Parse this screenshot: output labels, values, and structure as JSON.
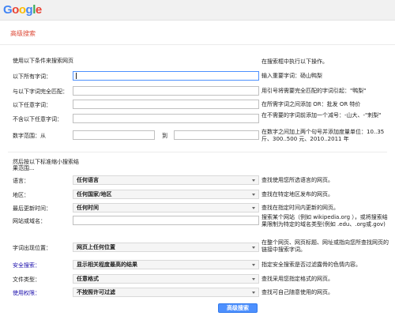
{
  "logo": {
    "letters": [
      {
        "char": "G",
        "color": "#4285f4"
      },
      {
        "char": "o",
        "color": "#ea4335"
      },
      {
        "char": "o",
        "color": "#fbbc05"
      },
      {
        "char": "g",
        "color": "#4285f4"
      },
      {
        "char": "l",
        "color": "#34a853"
      },
      {
        "char": "e",
        "color": "#ea4335"
      }
    ]
  },
  "page": {
    "title": "高级搜索"
  },
  "find": {
    "heading": "使用以下条件来搜索网页",
    "right_heading": "在搜索框中执行以下操作。",
    "rows": [
      {
        "label": "以下所有字词：",
        "value": "",
        "hint": "输入重要字词：砀山鸭梨"
      },
      {
        "label": "与以下字词完全匹配：",
        "value": "",
        "hint": "用引号将需要完全匹配的字词引起：\"鸭梨\""
      },
      {
        "label": "以下任意字词：",
        "value": "",
        "hint": "在所需字词之间添加 OR：批发 OR 特价"
      },
      {
        "label": "不含以下任意字词：",
        "value": "",
        "hint": "在不需要的字词前添加一个减号：-山大、-\"刺梨\""
      },
      {
        "label": "数字范围：从",
        "from": "",
        "to_label": "到",
        "to": "",
        "hint": "在数字之间加上两个句号并添加度量单位：10..35 斤、300..500 元、2010..2011 年"
      }
    ]
  },
  "narrow": {
    "heading": "然后按以下标准缩小搜索结果范围...",
    "rows": [
      {
        "label": "语言：",
        "value": "任何语言",
        "hint": "查找使用您所选语言的网页。",
        "link": false
      },
      {
        "label": "地区：",
        "value": "任何国家/地区",
        "hint": "查找在特定地区发布的网页。",
        "link": false
      },
      {
        "label": "最后更新时间：",
        "value": "任何时间",
        "hint": "查找在指定时间内更新的网页。",
        "link": false
      },
      {
        "label": "网站或域名：",
        "value": "",
        "hint": "搜索某个网站（例如 wikipedia.org ），或将搜索结果限制为特定的域名类型(例如 .edu、.org或.gov)",
        "link": false
      },
      {
        "label": "字词出现位置：",
        "value": "网页上任何位置",
        "hint": "在整个网页、网页标题、网址或指向您所查找网页的链接中搜索字词。",
        "link": false
      },
      {
        "label": "安全搜索：",
        "value": "显示相关程度最高的结果",
        "hint": "指定安全搜索是否过滤露骨的色情内容。",
        "link": true
      },
      {
        "label": "文件类型：",
        "value": "任意格式",
        "hint": "查找采用您指定格式的网页。",
        "link": false
      },
      {
        "label": "使用权限：",
        "value": "不按照许可过滤",
        "hint": "查找可自己随意使用的网页。",
        "link": true
      }
    ]
  },
  "submit_label": "高级搜索",
  "colors": {
    "accent": "#4d90fe",
    "title": "#dd4b39",
    "link": "#1a0dab"
  }
}
